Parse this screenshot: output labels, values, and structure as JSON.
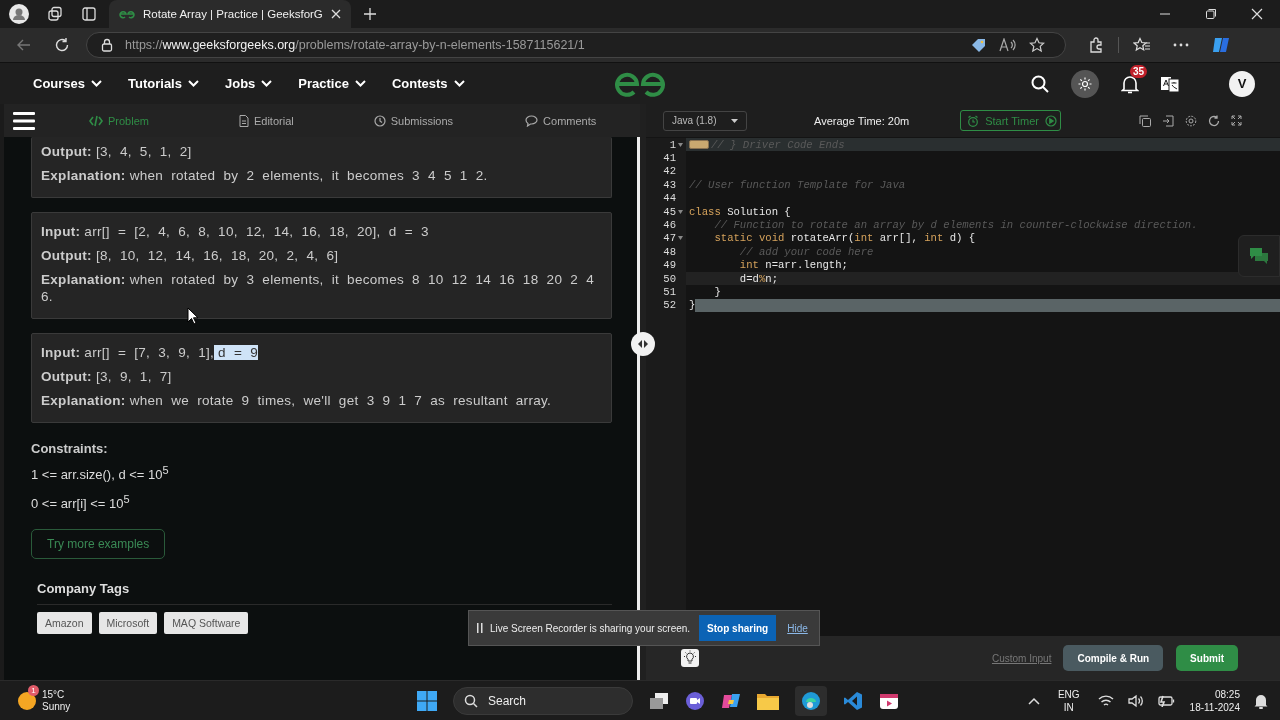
{
  "browser": {
    "tabs": [
      {
        "title": "Rotate Array | Practice | GeeksforG",
        "selected": true
      }
    ],
    "url": {
      "scheme": "https://",
      "host": "www.geeksforgeeks.org",
      "path": "/problems/rotate-array-by-n-elements-1587115621/1"
    }
  },
  "site_nav": {
    "items": [
      "Courses",
      "Tutorials",
      "Jobs",
      "Practice",
      "Contests"
    ],
    "notification_count": "35",
    "avatar": "V"
  },
  "problem_tabs": [
    {
      "label": "Problem",
      "selected": true
    },
    {
      "label": "Editorial",
      "selected": false
    },
    {
      "label": "Submissions",
      "selected": false
    },
    {
      "label": "Comments",
      "selected": false
    }
  ],
  "examples": [
    {
      "lines": [
        {
          "label": "Output:",
          "text": "[3,  4,  5,  1,  2]"
        },
        {
          "label": "Explanation:",
          "text": "when  rotated  by  2  elements,  it  becomes  3  4  5  1  2."
        }
      ]
    },
    {
      "lines": [
        {
          "label": "Input:",
          "text": "arr[]  =  [2,  4,  6,  8,  10,  12,  14,  16,  18,  20],  d  =  3"
        },
        {
          "label": "Output:",
          "text": "[8,  10,  12,  14,  16,  18,  20,  2,  4,  6]"
        },
        {
          "label": "Explanation:",
          "text": "when  rotated  by  3  elements,  it  becomes  8  10  12  14  16  18  20  2  4  6."
        }
      ]
    },
    {
      "lines": [
        {
          "label": "Input:",
          "text": "arr[]  =  [7,  3,  9,  1],",
          "selected_text": " d  =  9"
        },
        {
          "label": "Output:",
          "text": "[3,  9,  1,  7]"
        },
        {
          "label": "Explanation:",
          "text": "when  we  rotate  9  times,  we'll  get  3  9  1  7  as  resultant  array."
        }
      ]
    }
  ],
  "constraints": {
    "title": "Constraints:",
    "lines": [
      "1 <= arr.size(), d <= 10$^{5}$",
      "0 <= arr[i] <= 10$^{5}$"
    ]
  },
  "try_button": "Try more examples",
  "company_tags": {
    "title": "Company Tags",
    "tags": [
      "Amazon",
      "Microsoft",
      "MAQ Software"
    ]
  },
  "editor": {
    "language": "Java (1.8)",
    "average_time": "Average Time: 20m",
    "timer_button": "Start Timer",
    "lines": [
      {
        "number": "1",
        "collapsed": true,
        "current": false,
        "selected": false,
        "fold_arrow": true,
        "tokens": [
          {
            "kind": "comment",
            "text": "// } Driver Code Ends"
          }
        ]
      },
      {
        "number": "41",
        "collapsed": false,
        "current": false,
        "selected": false,
        "fold_arrow": false
      },
      {
        "number": "42",
        "collapsed": false,
        "current": false,
        "selected": false,
        "fold_arrow": false
      },
      {
        "number": "43",
        "collapsed": false,
        "current": false,
        "selected": false,
        "fold_arrow": false,
        "tokens": [
          {
            "kind": "comment",
            "text": "// User function Template for Java"
          }
        ]
      },
      {
        "number": "44",
        "collapsed": false,
        "current": false,
        "selected": false,
        "fold_arrow": false
      },
      {
        "number": "45",
        "collapsed": false,
        "current": false,
        "selected": false,
        "fold_arrow": true,
        "tokens": [
          {
            "kind": "keyword",
            "text": "class"
          },
          {
            "kind": "plain",
            "text": " Solution {"
          }
        ]
      },
      {
        "number": "46",
        "collapsed": false,
        "current": false,
        "selected": false,
        "fold_arrow": false,
        "tokens": [
          {
            "kind": "comment",
            "text": "    // Function to rotate an array by d elements in counter-clockwise direction."
          }
        ]
      },
      {
        "number": "47",
        "collapsed": false,
        "current": false,
        "selected": false,
        "fold_arrow": true,
        "tokens": [
          {
            "kind": "keyword",
            "text": "    static void"
          },
          {
            "kind": "plain",
            "text": " rotateArr("
          },
          {
            "kind": "keyword",
            "text": "int"
          },
          {
            "kind": "plain",
            "text": " arr[], "
          },
          {
            "kind": "keyword",
            "text": "int"
          },
          {
            "kind": "plain",
            "text": " d) {"
          }
        ]
      },
      {
        "number": "48",
        "collapsed": false,
        "current": false,
        "selected": false,
        "fold_arrow": false,
        "tokens": [
          {
            "kind": "comment",
            "text": "        // add your code here"
          }
        ]
      },
      {
        "number": "49",
        "collapsed": false,
        "current": false,
        "selected": false,
        "fold_arrow": false,
        "tokens": [
          {
            "kind": "keyword",
            "text": "        int"
          },
          {
            "kind": "plain",
            "text": " n=arr.length;"
          }
        ]
      },
      {
        "number": "50",
        "collapsed": false,
        "current": true,
        "selected": false,
        "fold_arrow": false,
        "tokens": [
          {
            "kind": "plain",
            "text": "        d=d"
          },
          {
            "kind": "keyword",
            "text": "%"
          },
          {
            "kind": "plain",
            "text": "n;"
          }
        ]
      },
      {
        "number": "51",
        "collapsed": false,
        "current": false,
        "selected": false,
        "fold_arrow": false,
        "tokens": [
          {
            "kind": "plain",
            "text": "    }"
          }
        ]
      },
      {
        "number": "52",
        "collapsed": false,
        "current": false,
        "selected": true,
        "fold_arrow": false,
        "tokens": [
          {
            "kind": "plain",
            "text": "}"
          }
        ]
      }
    ]
  },
  "editor_actions": {
    "custom_input": "Custom Input",
    "run_button": "Compile & Run",
    "submit_button": "Submit"
  },
  "share_notice": {
    "message": "Live Screen Recorder is sharing your screen.",
    "stop_button": "Stop sharing",
    "hide_link": "Hide"
  },
  "taskbar": {
    "weather": {
      "temperature": "15°C",
      "condition": "Sunny",
      "badge": "1"
    },
    "search": "Search",
    "language": [
      "ENG",
      "IN"
    ],
    "time": "08:25",
    "date": "18-11-2024"
  }
}
